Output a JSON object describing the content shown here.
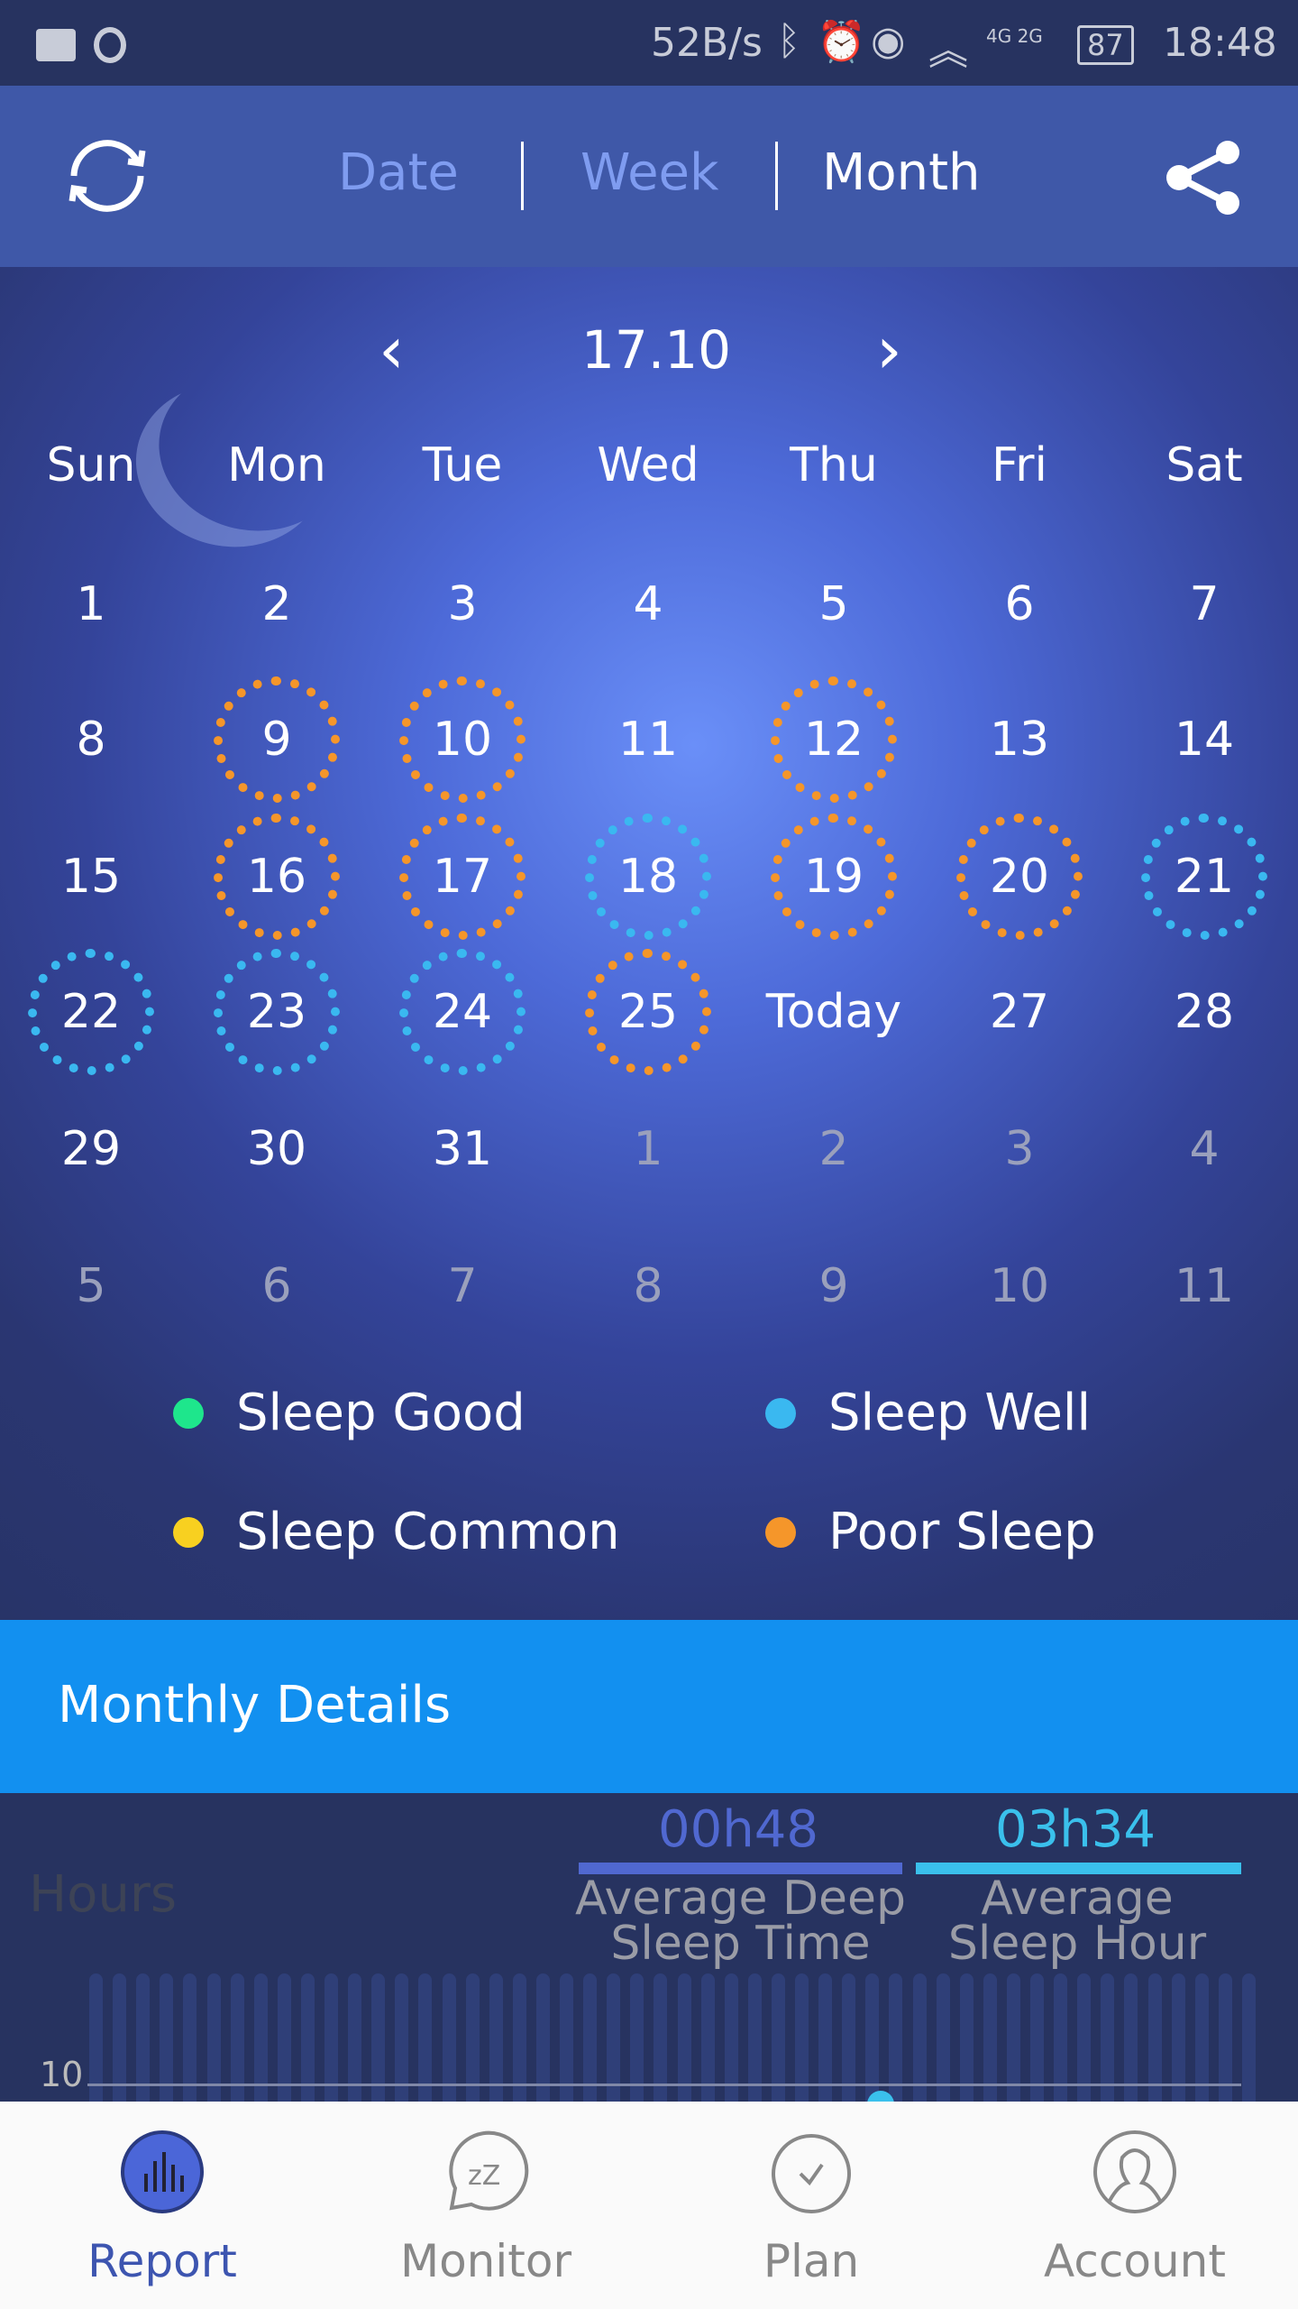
{
  "status_bar": {
    "net_speed": "52B/s",
    "signal": "4G 2G",
    "battery": "87",
    "time": "18:48",
    "icons": [
      "briefcase-icon",
      "app-notification-icon",
      "bluetooth-icon",
      "alarm-icon",
      "eye-icon",
      "wifi-icon",
      "cell-signal-icon",
      "battery-icon"
    ]
  },
  "header": {
    "tabs": [
      {
        "label": "Date",
        "active": false
      },
      {
        "label": "Week",
        "active": false
      },
      {
        "label": "Month",
        "active": true
      }
    ],
    "icons": [
      "refresh-icon",
      "share-icon"
    ]
  },
  "calendar": {
    "month_label": "17.10",
    "weekdays": [
      "Sun",
      "Mon",
      "Tue",
      "Wed",
      "Thu",
      "Fri",
      "Sat"
    ],
    "rows": [
      [
        {
          "d": "1"
        },
        {
          "d": "2"
        },
        {
          "d": "3"
        },
        {
          "d": "4"
        },
        {
          "d": "5"
        },
        {
          "d": "6"
        },
        {
          "d": "7"
        }
      ],
      [
        {
          "d": "8"
        },
        {
          "d": "9",
          "s": "poor"
        },
        {
          "d": "10",
          "s": "poor"
        },
        {
          "d": "11"
        },
        {
          "d": "12",
          "s": "poor"
        },
        {
          "d": "13"
        },
        {
          "d": "14"
        }
      ],
      [
        {
          "d": "15"
        },
        {
          "d": "16",
          "s": "poor"
        },
        {
          "d": "17",
          "s": "poor"
        },
        {
          "d": "18",
          "s": "well"
        },
        {
          "d": "19",
          "s": "poor"
        },
        {
          "d": "20",
          "s": "poor"
        },
        {
          "d": "21",
          "s": "well"
        }
      ],
      [
        {
          "d": "22",
          "s": "well"
        },
        {
          "d": "23",
          "s": "well"
        },
        {
          "d": "24",
          "s": "well"
        },
        {
          "d": "25",
          "s": "poor"
        },
        {
          "d": "Today"
        },
        {
          "d": "27"
        },
        {
          "d": "28"
        }
      ],
      [
        {
          "d": "29"
        },
        {
          "d": "30"
        },
        {
          "d": "31"
        },
        {
          "d": "1",
          "o": true
        },
        {
          "d": "2",
          "o": true
        },
        {
          "d": "3",
          "o": true
        },
        {
          "d": "4",
          "o": true
        }
      ],
      [
        {
          "d": "5",
          "o": true
        },
        {
          "d": "6",
          "o": true
        },
        {
          "d": "7",
          "o": true
        },
        {
          "d": "8",
          "o": true
        },
        {
          "d": "9",
          "o": true
        },
        {
          "d": "10",
          "o": true
        },
        {
          "d": "11",
          "o": true
        }
      ]
    ]
  },
  "legend": [
    {
      "label": "Sleep Good",
      "color": "#1ee68c"
    },
    {
      "label": "Sleep Well",
      "color": "#3ab8f0"
    },
    {
      "label": "Sleep Common",
      "color": "#f8d020"
    },
    {
      "label": "Poor Sleep",
      "color": "#f5962a"
    }
  ],
  "colors": {
    "poor": "#f5962a",
    "well": "#3ab8f0",
    "accent": "#1290f0",
    "active_nav": "#3d55b0"
  },
  "monthly": {
    "title": "Monthly Details",
    "deep_value": "00h48",
    "deep_label_1": "Average Deep",
    "deep_label_2": "Sleep Time",
    "sleep_value": "03h34",
    "sleep_label_1": "Average",
    "sleep_label_2": "Sleep Hour",
    "y_label": "Hours",
    "tick": "10"
  },
  "nav": [
    {
      "label": "Report",
      "icon": "report-icon",
      "active": true
    },
    {
      "label": "Monitor",
      "icon": "monitor-icon"
    },
    {
      "label": "Plan",
      "icon": "plan-icon"
    },
    {
      "label": "Account",
      "icon": "account-icon"
    }
  ]
}
